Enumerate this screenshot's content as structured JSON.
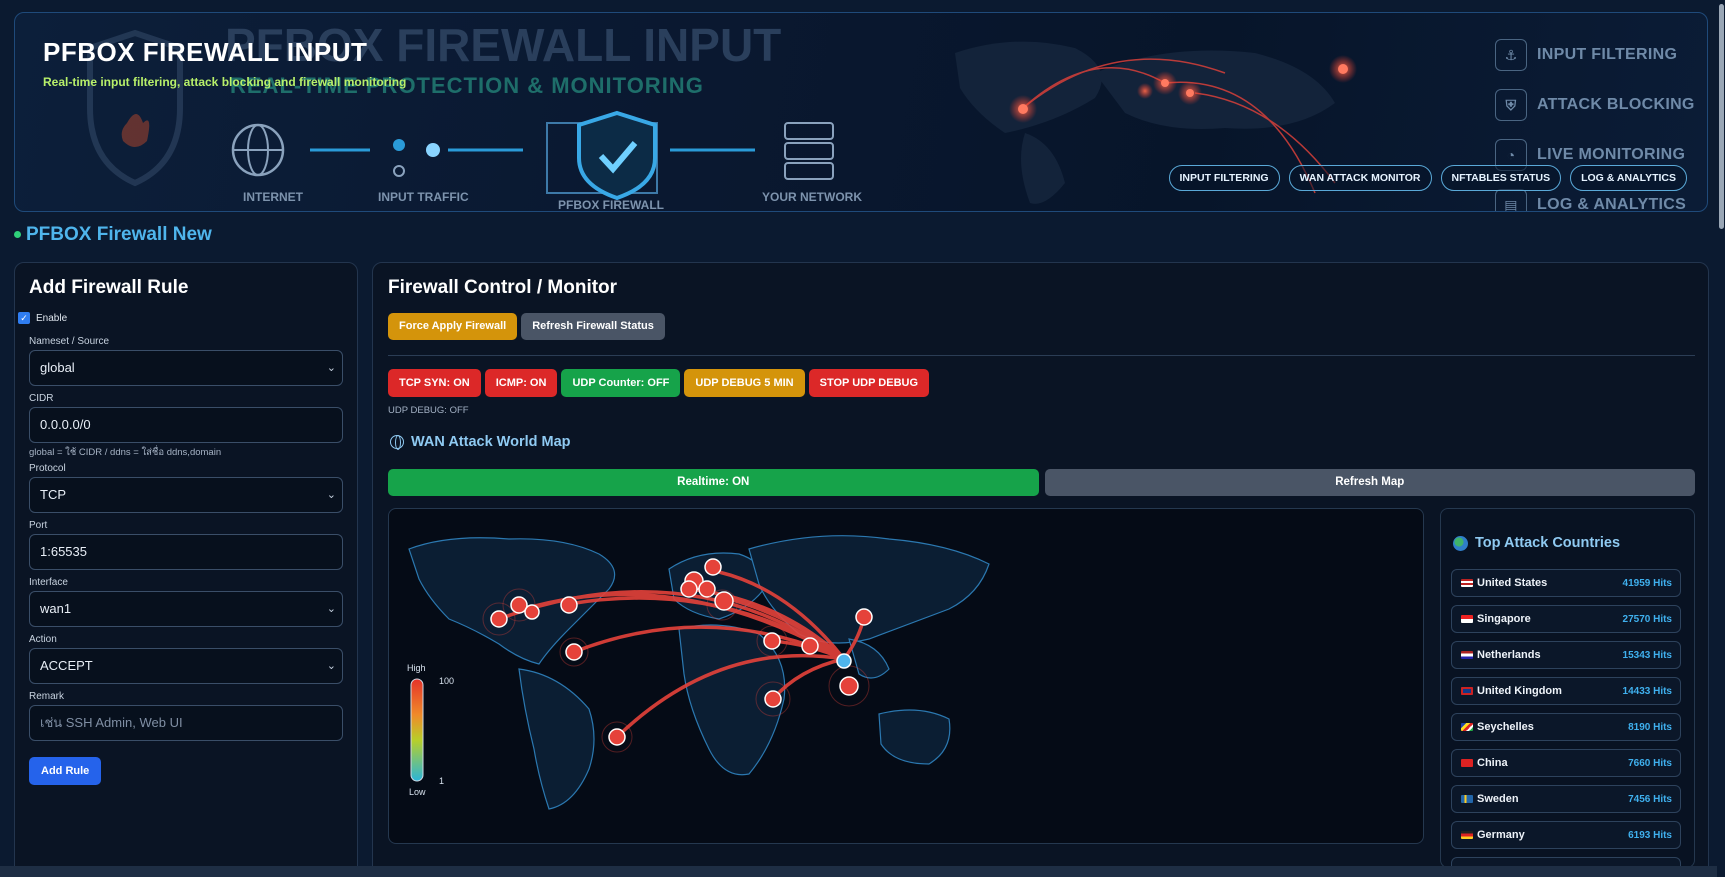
{
  "banner": {
    "title": "PFBOX FIREWALL INPUT",
    "subtitle": "Real-time input filtering, attack blocking and firewall monitoring",
    "nav": [
      "INPUT FILTERING",
      "WAN ATTACK MONITOR",
      "NFTABLES STATUS",
      "LOG & ANALYTICS"
    ],
    "art_title": "PFBOX FIREWALL INPUT",
    "art_subtitle": "REAL-TIME PROTECTION & MONITORING",
    "flow": [
      "INTERNET",
      "INPUT TRAFFIC",
      "PFBOX FIREWALL",
      "YOUR NETWORK"
    ],
    "features": [
      "INPUT FILTERING",
      "ATTACK BLOCKING",
      "LIVE MONITORING",
      "LOG & ANALYTICS"
    ]
  },
  "site_title": "PFBOX Firewall New",
  "add_rule": {
    "heading": "Add Firewall Rule",
    "enable_label": "Enable",
    "enable_checked": true,
    "nameset_label": "Nameset / Source",
    "nameset_value": "global",
    "cidr_label": "CIDR",
    "cidr_value": "0.0.0.0/0",
    "cidr_hint": "global = ใช้ CIDR / ddns = ใส่ชื่อ ddns,domain",
    "protocol_label": "Protocol",
    "protocol_value": "TCP",
    "port_label": "Port",
    "port_value": "1:65535",
    "interface_label": "Interface",
    "interface_value": "wan1",
    "action_label": "Action",
    "action_value": "ACCEPT",
    "remark_label": "Remark",
    "remark_placeholder": "เช่น SSH Admin, Web UI",
    "add_button": "Add Rule"
  },
  "control": {
    "heading": "Firewall Control / Monitor",
    "force_apply": "Force Apply Firewall",
    "refresh_status": "Refresh Firewall Status",
    "toggles": [
      "TCP SYN: ON",
      "ICMP: ON",
      "UDP Counter: OFF",
      "UDP DEBUG 5 MIN",
      "STOP UDP DEBUG"
    ],
    "udp_debug_status": "UDP DEBUG: OFF",
    "map_title": "WAN Attack World Map",
    "realtime": "Realtime: ON",
    "refresh_map": "Refresh Map",
    "legend": {
      "high": "High",
      "low": "Low",
      "max": "100",
      "min": "1"
    }
  },
  "top_countries": {
    "heading": "Top Attack Countries",
    "items": [
      {
        "country": "United States",
        "hits": "41959 Hits"
      },
      {
        "country": "Singapore",
        "hits": "27570 Hits"
      },
      {
        "country": "Netherlands",
        "hits": "15343 Hits"
      },
      {
        "country": "United Kingdom",
        "hits": "14433 Hits"
      },
      {
        "country": "Seychelles",
        "hits": "8190 Hits"
      },
      {
        "country": "China",
        "hits": "7660 Hits"
      },
      {
        "country": "Sweden",
        "hits": "7456 Hits"
      },
      {
        "country": "Germany",
        "hits": "6193 Hits"
      }
    ]
  },
  "colors": {
    "accent": "#4fb5ec",
    "danger": "#dc2828",
    "success": "#16a34a",
    "warning": "#d4940b",
    "primary": "#2563eb"
  }
}
